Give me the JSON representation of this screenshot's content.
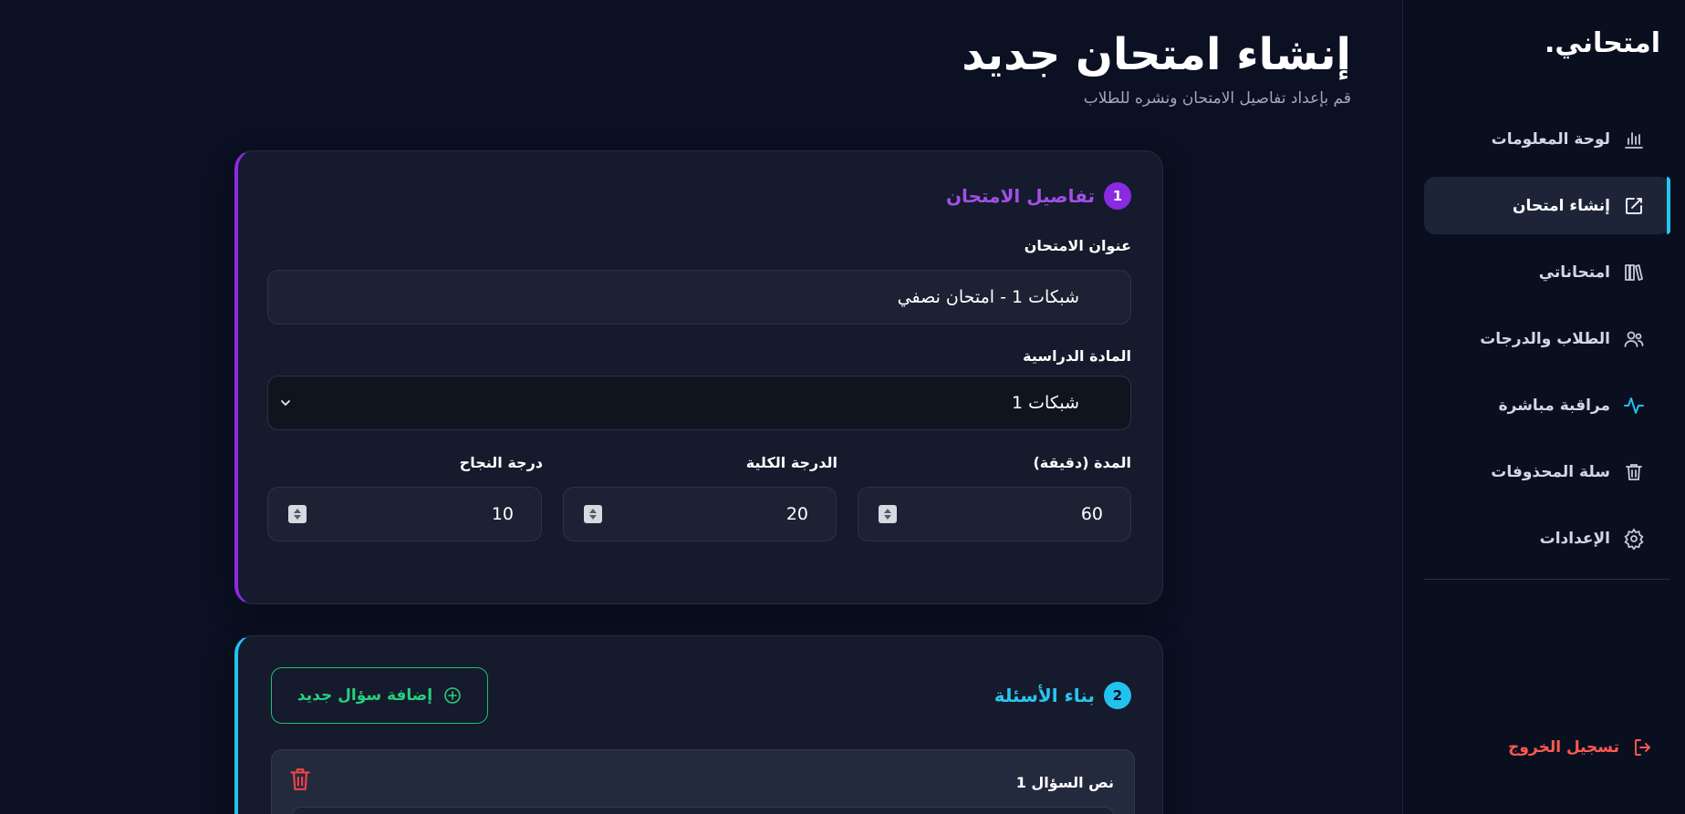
{
  "sidebar": {
    "logo": "امتحاني.",
    "items": [
      {
        "label": "لوحة المعلومات",
        "icon": "bar-chart-icon",
        "active": false
      },
      {
        "label": "إنشاء امتحان",
        "icon": "edit-icon",
        "active": true
      },
      {
        "label": "امتحاناتي",
        "icon": "library-icon",
        "active": false
      },
      {
        "label": "الطلاب والدرجات",
        "icon": "users-icon",
        "active": false
      },
      {
        "label": "مراقبة مباشرة",
        "icon": "activity-icon",
        "active": false
      },
      {
        "label": "سلة المحذوفات",
        "icon": "trash-icon",
        "active": false
      },
      {
        "label": "الإعدادات",
        "icon": "gear-icon",
        "active": false
      }
    ],
    "logout": "تسجيل الخروج"
  },
  "header": {
    "title": "إنشاء امتحان جديد",
    "subtitle": "قم بإعداد تفاصيل الامتحان ونشره للطلاب"
  },
  "details": {
    "step": "1",
    "title": "تفاصيل الامتحان",
    "exam_title_label": "عنوان الامتحان",
    "exam_title_value": "شبكات 1 - امتحان نصفي",
    "subject_label": "المادة الدراسية",
    "subject_value": "شبكات 1",
    "duration_label": "المدة (دقيقة)",
    "duration_value": "60",
    "total_label": "الدرجة الكلية",
    "total_value": "20",
    "pass_label": "درجة النجاح",
    "pass_value": "10"
  },
  "questions": {
    "step": "2",
    "title": "بناء الأسئلة",
    "add_button": "إضافة سؤال جديد",
    "question_label": "نص السؤال 1"
  },
  "colors": {
    "accent_purple": "#8a2be2",
    "accent_cyan": "#22c2ee",
    "accent_green": "#27d07f",
    "danger": "#ff5a4f"
  }
}
